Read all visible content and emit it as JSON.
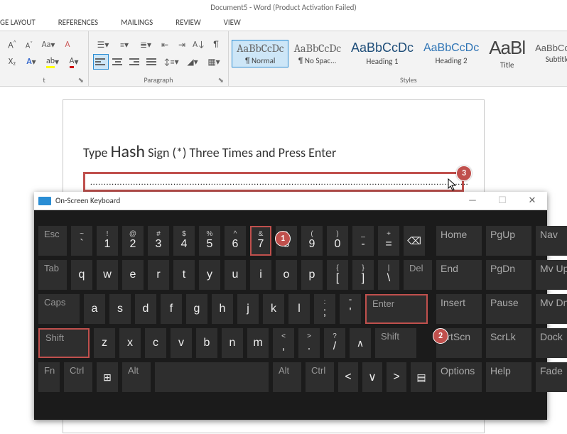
{
  "window": {
    "title": "Document5 - Word (Product Activation Failed)"
  },
  "tabs": {
    "layout": "GE LAYOUT",
    "references": "REFERENCES",
    "mailings": "MAILINGS",
    "review": "REVIEW",
    "view": "VIEW"
  },
  "groups": {
    "font_partial": "t",
    "paragraph": "Paragraph",
    "styles": "Styles"
  },
  "font": {
    "grow": "A^",
    "shrink": "A˅",
    "case": "Aa",
    "clear": "A",
    "sub": "X₂",
    "ab": "A",
    "hl": "ab",
    "color": "A"
  },
  "styles": {
    "preview": "AaBbCcDc",
    "preview_title": "AaBl",
    "items": [
      {
        "name": "¶ Normal"
      },
      {
        "name": "¶ No Spac..."
      },
      {
        "name": "Heading 1"
      },
      {
        "name": "Heading 2"
      },
      {
        "name": "Title"
      },
      {
        "name": "Subtitle"
      }
    ]
  },
  "document": {
    "instruction_pre": "Type ",
    "instruction_strong": "Hash",
    "instruction_post": " Sign (*) Three Times and Press Enter",
    "dots": "............................................................................................................................................."
  },
  "callouts": {
    "c1": "1",
    "c2": "2",
    "c3": "3"
  },
  "cursor_glyph": "↖",
  "osk": {
    "title": "On-Screen Keyboard",
    "win_min": "—",
    "win_max": "☐",
    "win_close": "✕",
    "rows": {
      "r1": [
        {
          "mod": "Esc"
        },
        {
          "u": "~",
          "l": "`"
        },
        {
          "u": "!",
          "l": "1"
        },
        {
          "u": "@",
          "l": "2"
        },
        {
          "u": "#",
          "l": "3"
        },
        {
          "u": "$",
          "l": "4"
        },
        {
          "u": "%",
          "l": "5"
        },
        {
          "u": "^",
          "l": "6"
        },
        {
          "u": "&",
          "l": "7"
        },
        {
          "u": "*",
          "l": "8"
        },
        {
          "u": "(",
          "l": "9"
        },
        {
          "u": ")",
          "l": "0"
        },
        {
          "u": "_",
          "l": "-"
        },
        {
          "u": "+",
          "l": "="
        },
        {
          "icon": "⌫"
        }
      ],
      "r2": [
        {
          "mod": "Tab"
        },
        {
          "l": "q"
        },
        {
          "l": "w"
        },
        {
          "l": "e"
        },
        {
          "l": "r"
        },
        {
          "l": "t"
        },
        {
          "l": "y"
        },
        {
          "l": "u"
        },
        {
          "l": "i"
        },
        {
          "l": "o"
        },
        {
          "l": "p"
        },
        {
          "u": "{",
          "l": "["
        },
        {
          "u": "}",
          "l": "]"
        },
        {
          "u": "|",
          "l": "\\"
        },
        {
          "mod": "Del"
        }
      ],
      "r3": [
        {
          "mod": "Caps"
        },
        {
          "l": "a"
        },
        {
          "l": "s"
        },
        {
          "l": "d"
        },
        {
          "l": "f"
        },
        {
          "l": "g"
        },
        {
          "l": "h"
        },
        {
          "l": "j"
        },
        {
          "l": "k"
        },
        {
          "l": "l"
        },
        {
          "u": ":",
          "l": ";"
        },
        {
          "u": "\"",
          "l": "'"
        },
        {
          "mod": "Enter"
        }
      ],
      "r4": [
        {
          "mod": "Shift"
        },
        {
          "l": "z"
        },
        {
          "l": "x"
        },
        {
          "l": "c"
        },
        {
          "l": "v"
        },
        {
          "l": "b"
        },
        {
          "l": "n"
        },
        {
          "l": "m"
        },
        {
          "u": "<",
          "l": ","
        },
        {
          "u": ">",
          "l": "."
        },
        {
          "u": "?",
          "l": "/"
        },
        {
          "icon": "∧"
        },
        {
          "mod": "Shift"
        }
      ],
      "r5": [
        {
          "mod": "Fn"
        },
        {
          "mod": "Ctrl"
        },
        {
          "icon": "⊞"
        },
        {
          "mod": "Alt"
        },
        {
          "space": true
        },
        {
          "mod": "Alt"
        },
        {
          "mod": "Ctrl"
        },
        {
          "icon": "<"
        },
        {
          "icon": "∨"
        },
        {
          "icon": ">"
        },
        {
          "icon": "▤"
        }
      ]
    },
    "nav": [
      [
        {
          "l": "Home"
        },
        {
          "l": "PgUp"
        },
        {
          "l": "Nav"
        }
      ],
      [
        {
          "l": "End"
        },
        {
          "l": "PgDn"
        },
        {
          "l": "Mv Up"
        }
      ],
      [
        {
          "l": "Insert"
        },
        {
          "l": "Pause"
        },
        {
          "l": "Mv Dn"
        }
      ],
      [
        {
          "l": "PrtScn"
        },
        {
          "l": "ScrLk"
        },
        {
          "l": "Dock"
        }
      ],
      [
        {
          "l": "Options"
        },
        {
          "l": "Help"
        },
        {
          "l": "Fade"
        }
      ]
    ]
  }
}
